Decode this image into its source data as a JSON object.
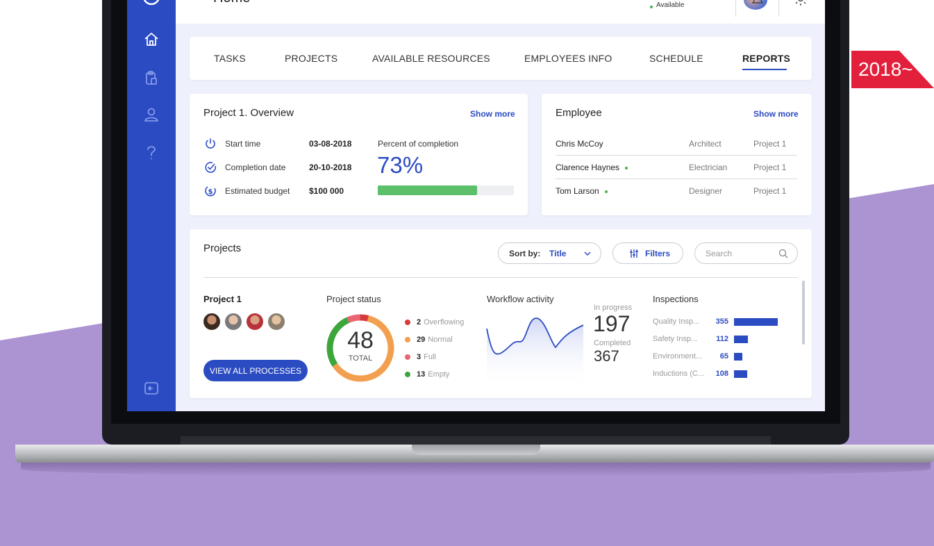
{
  "badge": {
    "text": "2018~"
  },
  "topbar": {
    "title": "Home",
    "status": "Available"
  },
  "tabs": [
    {
      "label": "TASKS"
    },
    {
      "label": "PROJECTS"
    },
    {
      "label": "AVAILABLE RESOURCES"
    },
    {
      "label": "EMPLOYEES INFO"
    },
    {
      "label": "SCHEDULE"
    },
    {
      "label": "REPORTS",
      "active": true
    }
  ],
  "overview": {
    "title": "Project 1. Overview",
    "show_more": "Show more",
    "rows": [
      {
        "icon": "power-icon",
        "label": "Start time",
        "value": "03-08-2018"
      },
      {
        "icon": "check-circle-icon",
        "label": "Completion date",
        "value": "20-10-2018"
      },
      {
        "icon": "dollar-circle-icon",
        "label": "Estimated budget",
        "value": "$100 000"
      }
    ],
    "percent_label": "Percent of completion",
    "percent_text": "73%",
    "percent_value": 0.73
  },
  "employee": {
    "title": "Employee",
    "show_more": "Show more",
    "rows": [
      {
        "name": "Chris McCoy",
        "role": "Architect",
        "project": "Project 1",
        "online": false
      },
      {
        "name": "Clarence Haynes",
        "role": "Electrician",
        "project": "Project 1",
        "online": true
      },
      {
        "name": "Tom Larson",
        "role": "Designer",
        "project": "Project 1",
        "online": true
      }
    ]
  },
  "projects": {
    "title": "Projects",
    "sort_label": "Sort by:",
    "sort_value": "Title",
    "filters_label": "Filters",
    "search_placeholder": "Search",
    "project_name": "Project 1",
    "view_all": "VIEW ALL PROCESSES",
    "status": {
      "title": "Project status",
      "total": "48",
      "total_label": "TOTAL",
      "items": [
        {
          "count": "2",
          "label": "Overflowing",
          "color": "#d63a3a"
        },
        {
          "count": "29",
          "label": "Normal",
          "color": "#f2a04f"
        },
        {
          "count": "3",
          "label": "Full",
          "color": "#e86572"
        },
        {
          "count": "13",
          "label": "Empty",
          "color": "#3ca63c"
        }
      ]
    },
    "workflow": {
      "title": "Workflow activity",
      "in_progress_label": "In progress",
      "in_progress": "197",
      "completed_label": "Completed",
      "completed": "367"
    },
    "inspections": {
      "title": "Inspections",
      "items": [
        {
          "label": "Quality Insp...",
          "value": "355"
        },
        {
          "label": "Safety Insp...",
          "value": "112"
        },
        {
          "label": "Environment...",
          "value": "65"
        },
        {
          "label": "Inductions (C...",
          "value": "108"
        }
      ]
    }
  },
  "colors": {
    "brand": "#2b4bc2",
    "progress": "#5cbf6a",
    "background": "#ac93d2",
    "badge": "#e3203c"
  }
}
